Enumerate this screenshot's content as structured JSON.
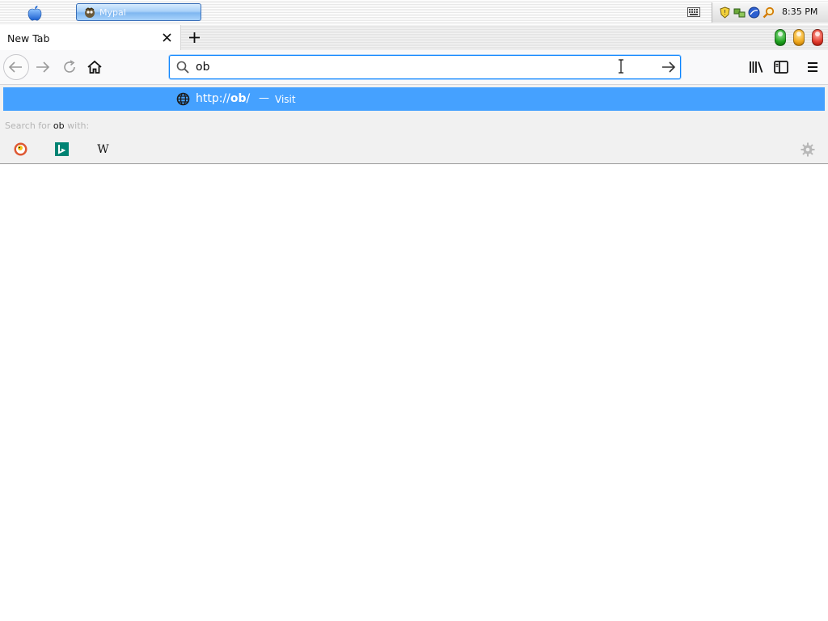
{
  "os_bar": {
    "apple_icon": "apple-icon",
    "task_button_label": "Mypal",
    "clock": "8:35 PM",
    "tray_icons": [
      "keyboard-icon",
      "shield-icon",
      "network-icon",
      "globe-icon",
      "search-icon"
    ]
  },
  "tabs": [
    {
      "label": "New Tab",
      "close_icon": "close-icon"
    }
  ],
  "window_controls": {
    "colors": [
      "#1fa21f",
      "#f0a81c",
      "#e23a2c"
    ]
  },
  "nav": {
    "back": "back-arrow-icon",
    "forward": "forward-arrow-icon",
    "reload": "reload-icon",
    "home": "home-icon",
    "library": "library-icon",
    "sidebar": "sidebar-icon",
    "menu": "hamburger-menu-icon"
  },
  "urlbar": {
    "value": "ob",
    "go_icon": "go-arrow-icon"
  },
  "popup": {
    "result": {
      "url_prefix": "http://",
      "url_bold": "ob",
      "url_suffix": "/",
      "dash": "—",
      "action": "Visit"
    },
    "search_with": {
      "prefix": "Search for",
      "query": "ob",
      "suffix": "with:"
    },
    "engines": [
      "duckduckgo-icon",
      "bing-icon",
      "wikipedia-icon"
    ],
    "wiki_letter": "W",
    "settings_icon": "gear-icon"
  },
  "colors": {
    "highlight": "#45a1ff",
    "focus_ring": "#0a84ff"
  }
}
